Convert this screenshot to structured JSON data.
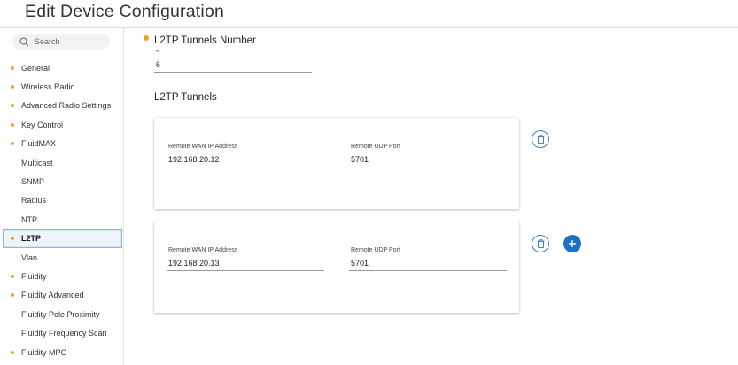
{
  "page": {
    "title": "Edit Device Configuration"
  },
  "search": {
    "label": "Search"
  },
  "sidebar": {
    "items": [
      {
        "label": "General",
        "dot": true,
        "active": false
      },
      {
        "label": "Wireless Radio",
        "dot": true,
        "active": false
      },
      {
        "label": "Advanced Radio Settings",
        "dot": true,
        "active": false
      },
      {
        "label": "Key Control",
        "dot": true,
        "active": false
      },
      {
        "label": "FluidMAX",
        "dot": true,
        "active": false
      },
      {
        "label": "Multicast",
        "dot": false,
        "active": false
      },
      {
        "label": "SNMP",
        "dot": false,
        "active": false
      },
      {
        "label": "Radius",
        "dot": false,
        "active": false
      },
      {
        "label": "NTP",
        "dot": false,
        "active": false
      },
      {
        "label": "L2TP",
        "dot": true,
        "active": true
      },
      {
        "label": "Vlan",
        "dot": false,
        "active": false
      },
      {
        "label": "Fluidity",
        "dot": true,
        "active": false
      },
      {
        "label": "Fluidity Advanced",
        "dot": true,
        "active": false
      },
      {
        "label": "Fluidity Pole Proximity",
        "dot": false,
        "active": false
      },
      {
        "label": "Fluidity Frequency Scan",
        "dot": false,
        "active": false
      },
      {
        "label": "Fluidity MPO",
        "dot": true,
        "active": false
      }
    ]
  },
  "main": {
    "tunnels_number": {
      "label": "L2TP Tunnels Number",
      "required_mark": "*",
      "value": "6"
    },
    "tunnels_title": "L2TP Tunnels",
    "tunnels": [
      {
        "ip_label": "Remote WAN IP Address",
        "ip_value": "192.168.20.12",
        "port_label": "Remote UDP Port",
        "port_value": "5701"
      },
      {
        "ip_label": "Remote WAN IP Address",
        "ip_value": "192.168.20.13",
        "port_label": "Remote UDP Port",
        "port_value": "5701"
      }
    ]
  },
  "icons": {
    "search": "search-icon",
    "delete": "trash-icon",
    "add": "plus-icon"
  },
  "colors": {
    "accent": "#1f6fc4",
    "status_dot": "#f0a020",
    "active_border": "#8fb6de"
  }
}
